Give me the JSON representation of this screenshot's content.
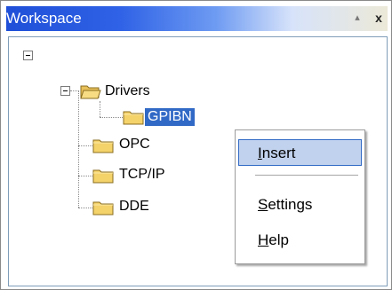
{
  "workspace": {
    "title": "Workspace",
    "pin_icon": "pin-icon",
    "close_icon": "close-icon",
    "pin_glyph": "▴",
    "close_glyph": "x"
  },
  "tree": {
    "root_expander": "collapse-icon",
    "nodes": [
      {
        "label": "Drivers",
        "expanded": true
      },
      {
        "label": "GPIBN",
        "selected": true
      },
      {
        "label": "OPC"
      },
      {
        "label": "TCP/IP"
      },
      {
        "label": "DDE"
      }
    ]
  },
  "context_menu": {
    "items": [
      {
        "label_mnemonic": "I",
        "label_rest": "nsert",
        "highlighted": true
      },
      {
        "label_mnemonic": "S",
        "label_rest": "ettings"
      },
      {
        "label_mnemonic": "H",
        "label_rest": "elp"
      }
    ]
  },
  "colors": {
    "title_gradient_start": "#1f4fd8",
    "selection": "#3169c6",
    "menu_highlight": "#c1d2ee",
    "folder": "#f5d36b"
  }
}
